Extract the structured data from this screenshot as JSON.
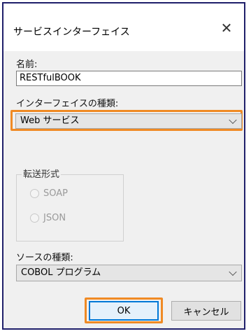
{
  "window": {
    "title": "サービスインターフェイス",
    "close_symbol": "✕"
  },
  "name_field": {
    "label": "名前:",
    "value": "RESTfulBOOK"
  },
  "interface_type": {
    "label": "インターフェイスの種類:",
    "selected": "Web サービス"
  },
  "transfer_format": {
    "label": "転送形式",
    "options": [
      "SOAP",
      "JSON"
    ]
  },
  "source_type": {
    "label": "ソースの種類:",
    "selected": "COBOL プログラム"
  },
  "buttons": {
    "ok": "OK",
    "cancel": "キャンセル"
  },
  "colors": {
    "highlight": "#f08a24",
    "window_border": "#1f1f6a",
    "focus": "#0078d7"
  }
}
